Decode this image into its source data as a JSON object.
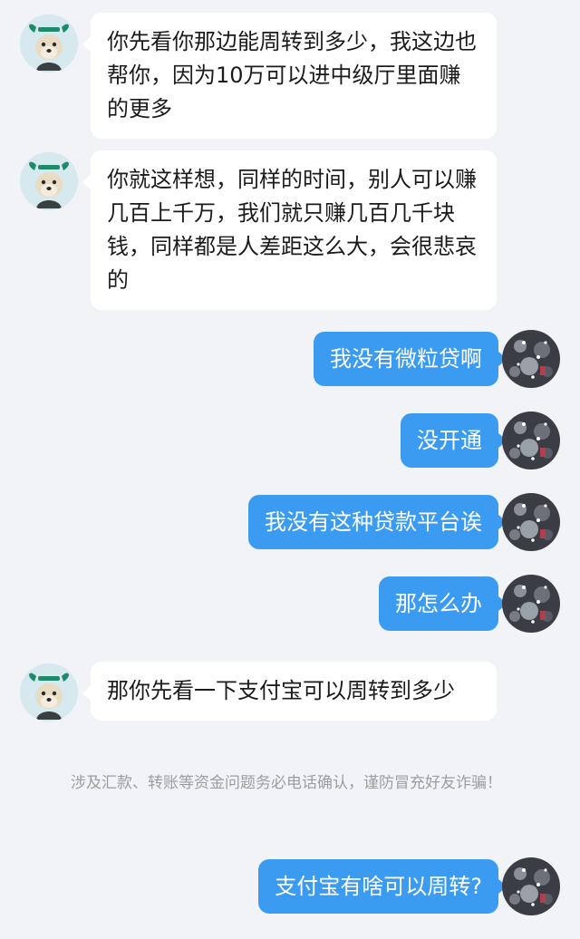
{
  "messages": [
    {
      "side": "incoming",
      "text": "你先看你那边能周转到多少，我这边也帮你，因为10万可以进中级厅里面赚的更多"
    },
    {
      "side": "incoming",
      "text": "你就这样想，同样的时间，别人可以赚几百上千万，我们就只赚几百几千块钱，同样都是人差距这么大，会很悲哀的"
    },
    {
      "side": "outgoing",
      "text": "我没有微粒贷啊"
    },
    {
      "side": "outgoing",
      "text": "没开通"
    },
    {
      "side": "outgoing",
      "text": "我没有这种贷款平台诶"
    },
    {
      "side": "outgoing",
      "text": "那怎么办"
    },
    {
      "side": "incoming",
      "text": "那你先看一下支付宝可以周转到多少"
    },
    {
      "side": "outgoing",
      "text": "支付宝有啥可以周转?"
    }
  ],
  "notice": {
    "text": "涉及汇款、转账等资金问题务必电话确认，谨防冒充好友诈骗！"
  },
  "avatars": {
    "contact_icon": "dog-with-green-ears-avatar-icon",
    "self_icon": "dark-sparkle-photo-avatar-icon"
  },
  "colors": {
    "background": "#f1f3f7",
    "incoming_bubble": "#ffffff",
    "outgoing_bubble": "#3a9bf0",
    "notice_text": "#9a9da3"
  }
}
